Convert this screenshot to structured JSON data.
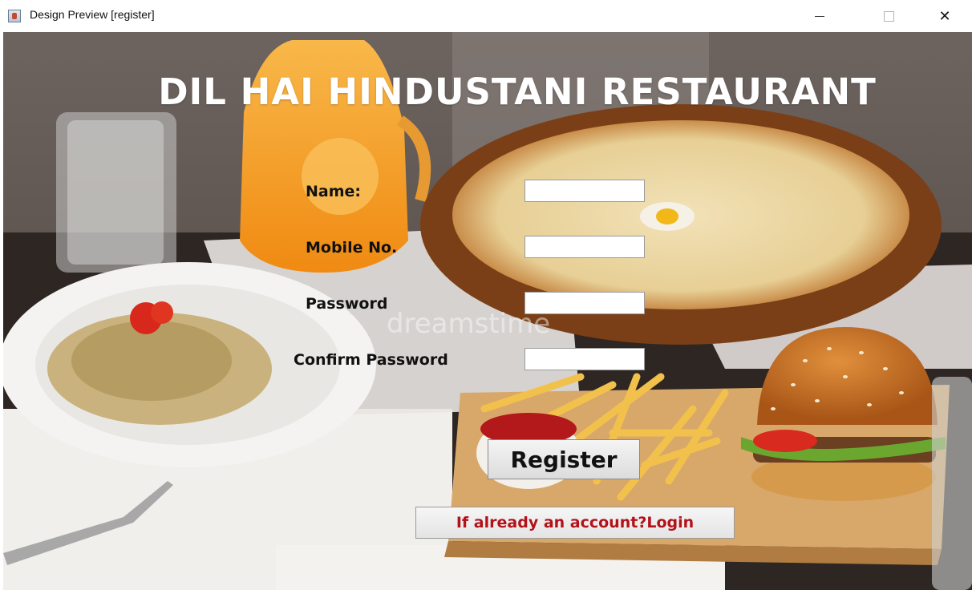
{
  "window": {
    "title": "Design Preview [register]",
    "controls": {
      "minimize": "minimize",
      "maximize": "maximize",
      "close": "✕"
    }
  },
  "header": {
    "title": "DIL HAI HINDUSTANI RESTAURANT"
  },
  "form": {
    "name_label": "Name:",
    "name_value": "",
    "mobile_label": "Mobile No.",
    "mobile_value": "",
    "password_label": "Password",
    "password_value": "",
    "confirm_label": "Confirm Password",
    "confirm_value": "",
    "register_label": "Register",
    "login_link_label": "If already an account?Login"
  },
  "background": {
    "description_icon": "restaurant-photo",
    "watermark": "dreamstime"
  },
  "colors": {
    "heading": "#ffffff",
    "login_link": "#b3121a",
    "label": "#111111"
  }
}
